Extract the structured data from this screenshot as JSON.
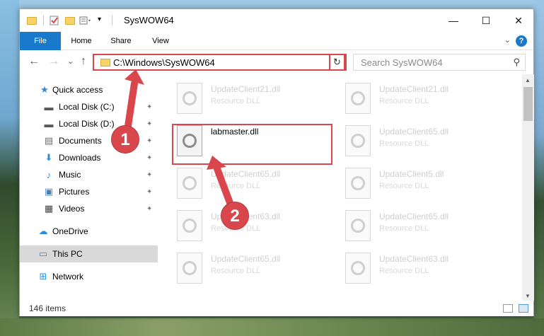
{
  "window": {
    "title": "SysWOW64",
    "minimize_glyph": "—",
    "maximize_glyph": "☐",
    "close_glyph": "✕"
  },
  "ribbon": {
    "tabs": [
      "File",
      "Home",
      "Share",
      "View"
    ],
    "help": "?",
    "collapse_glyph": "⌄"
  },
  "nav": {
    "back": "←",
    "forward": "→",
    "recent": "⌄",
    "up": "↑",
    "address": "C:\\Windows\\SysWOW64",
    "address_dropdown": "⌄",
    "refresh": "↻",
    "search_placeholder": "Search SysWOW64",
    "search_glyph": "⚲"
  },
  "sidebar": {
    "items": [
      {
        "label": "Quick access",
        "icon": "star-icon",
        "glyph": "★",
        "color": "#2e8bd6",
        "pinned": false
      },
      {
        "label": "Local Disk (C:)",
        "icon": "drive-icon",
        "glyph": "▬",
        "color": "#5a5a5a",
        "pinned": true
      },
      {
        "label": "Local Disk (D:)",
        "icon": "drive-icon",
        "glyph": "▬",
        "color": "#5a5a5a",
        "pinned": true
      },
      {
        "label": "Documents",
        "icon": "documents-icon",
        "glyph": "▤",
        "color": "#6b6b6b",
        "pinned": true
      },
      {
        "label": "Downloads",
        "icon": "downloads-icon",
        "glyph": "⬇",
        "color": "#2e8bd6",
        "pinned": true
      },
      {
        "label": "Music",
        "icon": "music-icon",
        "glyph": "♪",
        "color": "#2e8bd6",
        "pinned": true
      },
      {
        "label": "Pictures",
        "icon": "pictures-icon",
        "glyph": "▣",
        "color": "#4a7fb5",
        "pinned": true
      },
      {
        "label": "Videos",
        "icon": "videos-icon",
        "glyph": "▦",
        "color": "#444444",
        "pinned": true
      },
      {
        "label": "OneDrive",
        "icon": "onedrive-icon",
        "glyph": "☁",
        "color": "#2e8bd6",
        "pinned": false
      },
      {
        "label": "This PC",
        "icon": "this-pc-icon",
        "glyph": "▭",
        "color": "#2e8bd6",
        "pinned": false,
        "selected": true
      },
      {
        "label": "Network",
        "icon": "network-icon",
        "glyph": "⊞",
        "color": "#2e8bd6",
        "pinned": false
      }
    ],
    "pin_glyph": "📌"
  },
  "files": [
    {
      "name": "UpdateClient21.dll",
      "type": "Resource DLL"
    },
    {
      "name": "UpdateClient21.dll",
      "type": "Resource DLL"
    },
    {
      "name": "labmaster.dll",
      "type": ""
    },
    {
      "name": "UpdateClient65.dll",
      "type": "Resource DLL"
    },
    {
      "name": "UpdateClient65.dll",
      "type": "Resource DLL"
    },
    {
      "name": "UpdateClient5.dll",
      "type": "Resource DLL"
    },
    {
      "name": "UpdateClient63.dll",
      "type": "Resource DLL"
    },
    {
      "name": "UpdateClient65.dll",
      "type": "Resource DLL"
    },
    {
      "name": "UpdateClient65.dll",
      "type": "Resource DLL"
    },
    {
      "name": "UpdateClient63.dll",
      "type": "Resource DLL"
    }
  ],
  "status": {
    "item_count": "146 items"
  },
  "annotations": {
    "step1": "1",
    "step2": "2",
    "color": "#d9474d"
  },
  "scrollbar": {
    "up": "▲",
    "down": "▼"
  }
}
